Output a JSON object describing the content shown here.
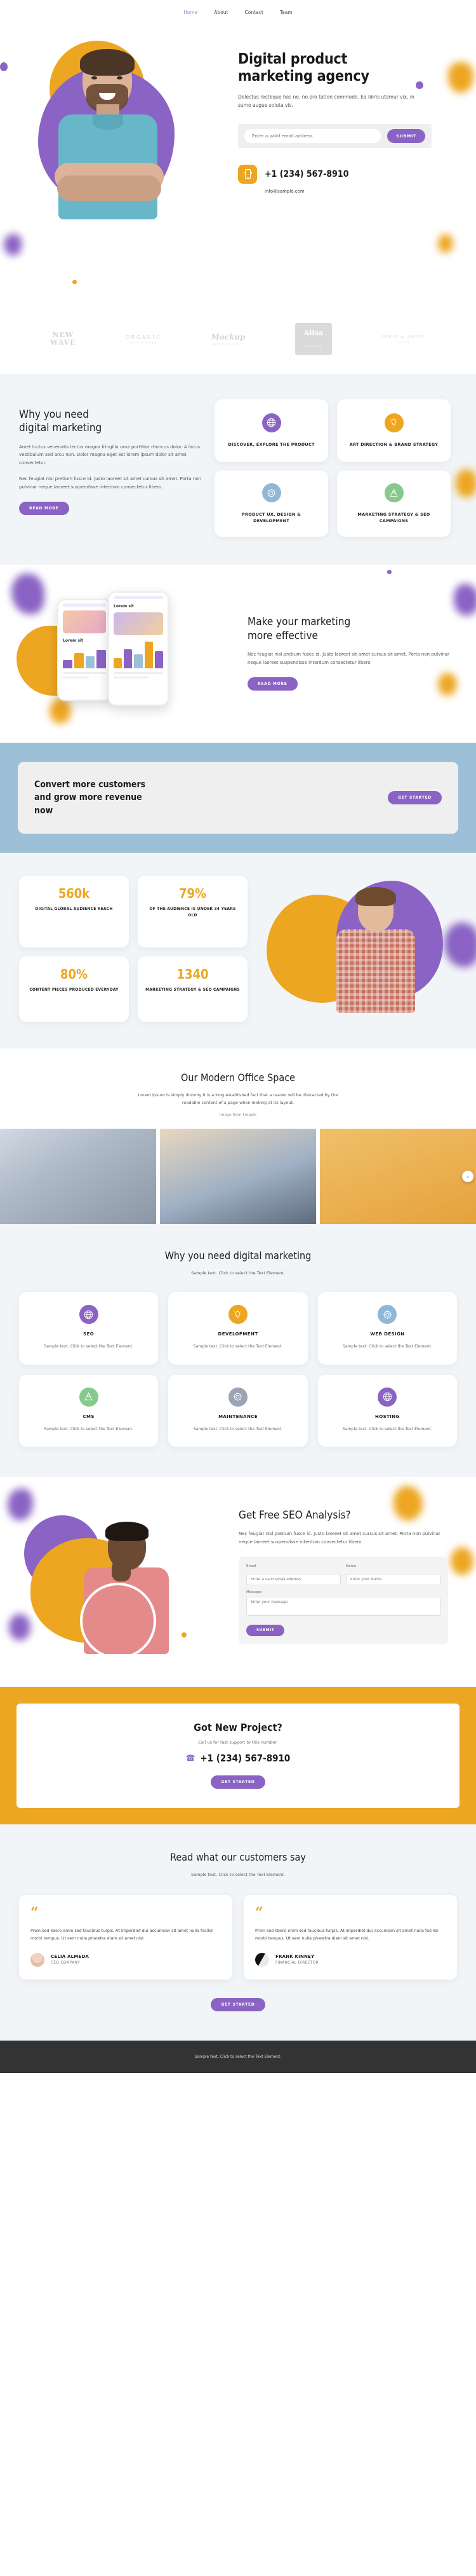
{
  "nav": {
    "items": [
      {
        "label": "Home",
        "active": true
      },
      {
        "label": "About",
        "active": false
      },
      {
        "label": "Contact",
        "active": false
      },
      {
        "label": "Team",
        "active": false
      }
    ]
  },
  "hero": {
    "title_line1": "Digital product",
    "title_line2": "marketing agency",
    "subtitle": "Delectus recteque has ne, no pro tation commodo. Ea libris utamur vix, in sumo augue soluta vis.",
    "email_placeholder": "Enter a valid email address",
    "email_value": "",
    "submit_label": "SUBMIT",
    "phone": "+1 (234) 567-8910",
    "email": "info@sample.com",
    "phone_icon": "mobile-phone-icon"
  },
  "logos": [
    {
      "name": "NEW WAVE",
      "line1": "NEW",
      "line2": "WAVE"
    },
    {
      "name": "ORGANIC",
      "line1": "ORGANIC",
      "line2": "FOOD & DRINK"
    },
    {
      "name": "Mockup",
      "line1": "Mockup",
      "line2": "BARE RESTAURANT"
    },
    {
      "name": "Alisa",
      "line1": "Alisa",
      "line2": "BOUTIQUE"
    },
    {
      "name": "JAMIE & ANNIE",
      "line1": "JAMIE & ANNIE",
      "line2": "STUDIO"
    }
  ],
  "why": {
    "title_line1": "Why you need",
    "title_line2": "digital marketing",
    "paragraph1": "Amet luctus venenatis lectus magna fringilla urna porttitor rhoncus dolor. A lacus vestibulum sed arcu non. Dolor magna eget est lorem ipsum dolor sit amet consectetur.",
    "paragraph2": "Nec feugiat nisl pretium fusce id. Justo laoreet sit amet cursus sit amet. Porta non pulvinar neque laoreet suspendisse interdum consectetur libero.",
    "button_label": "READ MORE",
    "cards": [
      {
        "label": "DISCOVER, EXPLORE THE PRODUCT",
        "icon": "globe-icon",
        "color": "#8a63c4"
      },
      {
        "label": "ART DIRECTION & BRAND STRATEGY",
        "icon": "lightbulb-icon",
        "color": "#eda621"
      },
      {
        "label": "PRODUCT UX, DESIGN & DEVELOPMENT",
        "icon": "gear-icon",
        "color": "#8fb8d8"
      },
      {
        "label": "MARKETING STRATEGY & SEO CAMPAIGNS",
        "icon": "map-pin-icon",
        "color": "#85c98c"
      }
    ]
  },
  "effective": {
    "title_line1": "Make your marketing",
    "title_line2": "more effective",
    "paragraph": "Nec feugiat nisl pretium fusce id. Justo laoreet sit amet cursus sit amet. Porta non pulvinar neque laoreet suspendisse interdum consectetur libero.",
    "button_label": "READ MORE",
    "phone_a_title": "Lorem sit",
    "phone_b_title": "Lorem sit"
  },
  "convert": {
    "title_line1": "Convert more customers",
    "title_line2": "and grow more revenue",
    "title_line3": "now",
    "button_label": "GET STARTED"
  },
  "stats": [
    {
      "value": "560k",
      "label": "DIGITAL GLOBAL AUDIENCE REACH"
    },
    {
      "value": "79%",
      "label": "OF THE AUDIENCE IS UNDER 34 YEARS OLD"
    },
    {
      "value": "80%",
      "label": "CONTENT PIECES PRODUCED EVERYDAY"
    },
    {
      "value": "1340",
      "label": "MARKETING STRATEGY & SEO CAMPAIGNS"
    }
  ],
  "office": {
    "title": "Our Modern Office Space",
    "paragraph": "Lorem Ipsum is simply dummy It is a long established fact that a reader will be distracted by the readable content of a page when looking at its layout.",
    "credit": "Image from Freepik",
    "next_arrow": "chevron-right-icon"
  },
  "services": {
    "title": "Why you need digital marketing",
    "subtitle": "Sample text. Click to select the Text Element.",
    "cards": [
      {
        "title": "SEO",
        "text": "Sample text. Click to select the Text Element.",
        "icon": "globe-icon",
        "color": "#8a63c4"
      },
      {
        "title": "DEVELOPMENT",
        "text": "Sample text. Click to select the Text Element.",
        "icon": "lightbulb-icon",
        "color": "#eda621"
      },
      {
        "title": "WEB DESIGN",
        "text": "Sample text. Click to select the Text Element.",
        "icon": "gear-icon",
        "color": "#8fb8d8"
      },
      {
        "title": "CMS",
        "text": "Sample text. Click to select the Text Element.",
        "icon": "map-pin-icon",
        "color": "#85c98c"
      },
      {
        "title": "MAINTENANCE",
        "text": "Sample text. Click to select the Text Element.",
        "icon": "gear-icon",
        "color": "#9aa4b2"
      },
      {
        "title": "HOSTING",
        "text": "Sample text. Click to select the Text Element.",
        "icon": "globe-icon",
        "color": "#8a63c4"
      }
    ]
  },
  "seo": {
    "title": "Get Free SEO Analysis?",
    "paragraph": "Nec feugiat nisl pretium fusce id. Justo laoreet sit amet cursus sit amet. Porta non pulvinar neque laoreet suspendisse interdum consectetur libero.",
    "email_label": "Email",
    "email_placeholder": "Enter a valid email address",
    "name_label": "Name",
    "name_placeholder": "Enter your Name",
    "message_label": "Message",
    "message_placeholder": "Enter your message",
    "submit_label": "SUBMIT"
  },
  "cta": {
    "title": "Got New Project?",
    "subtitle": "Call us for fast support to this number.",
    "phone": "+1 (234) 567-8910",
    "phone_icon": "phone-icon",
    "button_label": "GET STARTED"
  },
  "testimonials": {
    "title": "Read what our customers say",
    "subtitle": "Sample text. Click to select the Text Element.",
    "button_label": "GET STARTED",
    "items": [
      {
        "quote_mark": "“",
        "text": "Proin sed libero enim sed faucibus turpis. At imperdiet dui accumsan sit amet nulla facilisi morbi tempus. Ut sem nulla pharetra diam sit amet nisl.",
        "name": "CELIA ALMEDA",
        "role": "CEO COMPANY",
        "avatar": "avatar-celia"
      },
      {
        "quote_mark": "“",
        "text": "Proin sed libero enim sed faucibus turpis. At imperdiet dui accumsan sit amet nulla facilisi morbi tempus. Ut sem nulla pharetra diam sit amet nisl.",
        "name": "FRANK KINNEY",
        "role": "FINANCIAL DIRECTOR",
        "avatar": "avatar-frank"
      }
    ]
  },
  "footer": {
    "text": "Sample text. Click to select the Text Element."
  },
  "colors": {
    "purple": "#8a63c4",
    "orange": "#eda621",
    "blue": "#9dc0d8",
    "light_bg": "#f2f5f8",
    "dark_footer": "#333333"
  }
}
